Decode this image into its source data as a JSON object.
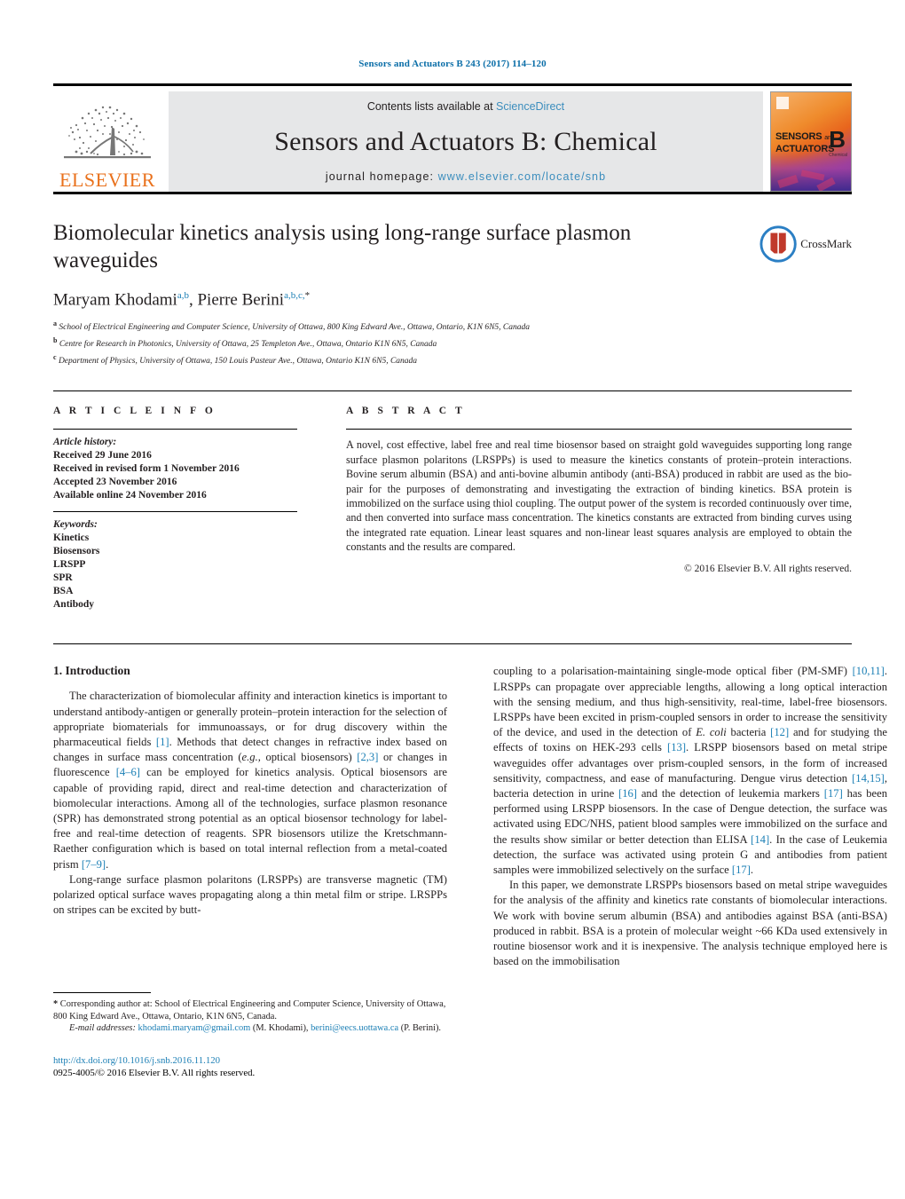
{
  "running_head": "Sensors and Actuators B 243 (2017) 114–120",
  "masthead": {
    "publisher": "ELSEVIER",
    "contents_prefix": "Contents lists available at ",
    "contents_link": "ScienceDirect",
    "journal_title": "Sensors and Actuators B: Chemical",
    "homepage_prefix": "journal homepage: ",
    "homepage_url": "www.elsevier.com/locate/snb",
    "cover": {
      "line1": "SENSORS",
      "line1_small": "and",
      "line2": "ACTUATORS",
      "letter": "B",
      "letter_sub": "Chemical"
    }
  },
  "article": {
    "title": "Biomolecular kinetics analysis using long-range surface plasmon waveguides",
    "crossmark_label": "CrossMark",
    "authors_html": "Maryam Khodami<sup>a,b</sup>, Pierre Berini<sup>a,b,c,<span class=\"star\">*</span></sup>",
    "affiliations": [
      {
        "mark": "a",
        "text": "School of Electrical Engineering and Computer Science, University of Ottawa, 800 King Edward Ave., Ottawa, Ontario, K1N 6N5, Canada"
      },
      {
        "mark": "b",
        "text": "Centre for Research in Photonics, University of Ottawa, 25 Templeton Ave., Ottawa, Ontario K1N 6N5, Canada"
      },
      {
        "mark": "c",
        "text": "Department of Physics, University of Ottawa, 150 Louis Pasteur Ave., Ottawa, Ontario K1N 6N5, Canada"
      }
    ]
  },
  "article_info": {
    "heading": "A R T I C L E    I N F O",
    "history_title": "Article history:",
    "history": [
      "Received 29 June 2016",
      "Received in revised form 1 November 2016",
      "Accepted 23 November 2016",
      "Available online 24 November 2016"
    ],
    "keywords_title": "Keywords:",
    "keywords": [
      "Kinetics",
      "Biosensors",
      "LRSPP",
      "SPR",
      "BSA",
      "Antibody"
    ]
  },
  "abstract": {
    "heading": "A B S T R A C T",
    "text": "A novel, cost effective, label free and real time biosensor based on straight gold waveguides supporting long range surface plasmon polaritons (LRSPPs) is used to measure the kinetics constants of protein–protein interactions. Bovine serum albumin (BSA) and anti-bovine albumin antibody (anti-BSA) produced in rabbit are used as the bio-pair for the purposes of demonstrating and investigating the extraction of binding kinetics. BSA protein is immobilized on the surface using thiol coupling. The output power of the system is recorded continuously over time, and then converted into surface mass concentration. The kinetics constants are extracted from binding curves using the integrated rate equation. Linear least squares and non-linear least squares analysis are employed to obtain the constants and the results are compared.",
    "copyright": "© 2016 Elsevier B.V. All rights reserved."
  },
  "body": {
    "section_heading": "1.  Introduction",
    "left_paragraphs": [
      "The characterization of biomolecular affinity and interaction kinetics is important to understand antibody-antigen or generally protein–protein interaction for the selection of appropriate biomaterials for immunoassays, or for drug discovery within the pharmaceutical fields <span class=\"ref\">[1]</span>. Methods that detect changes in refractive index based on changes in surface mass concentration (<span class=\"ital\">e.g.,</span> optical biosensors) <span class=\"ref\">[2,3]</span> or changes in fluorescence <span class=\"ref\">[4–6]</span> can be employed for kinetics analysis. Optical biosensors are capable of providing rapid, direct and real-time detection and characterization of biomolecular interactions. Among all of the technologies, surface plasmon resonance (SPR) has demonstrated strong potential as an optical biosensor technology for label-free and real-time detection of reagents. SPR biosensors utilize the Kretschmann-Raether configuration which is based on total internal reflection from a metal-coated prism <span class=\"ref\">[7–9]</span>.",
      "Long-range surface plasmon polaritons (LRSPPs) are transverse magnetic (TM) polarized optical surface waves propagating along a thin metal film or stripe. LRSPPs on stripes can be excited by butt-"
    ],
    "right_paragraphs": [
      "coupling to a polarisation-maintaining single-mode optical fiber (PM-SMF) <span class=\"ref\">[10,11]</span>. LRSPPs can propagate over appreciable lengths, allowing a long optical interaction with the sensing medium, and thus high-sensitivity, real-time, label-free biosensors. LRSPPs have been excited in prism-coupled sensors in order to increase the sensitivity of the device, and used in the detection of <span class=\"ital\">E. coli</span> bacteria <span class=\"ref\">[12]</span> and for studying the effects of toxins on HEK-293 cells <span class=\"ref\">[13]</span>. LRSPP biosensors based on metal stripe waveguides offer advantages over prism-coupled sensors, in the form of increased sensitivity, compactness, and ease of manufacturing. Dengue virus detection <span class=\"ref\">[14,15]</span>, bacteria detection in urine <span class=\"ref\">[16]</span> and the detection of leukemia markers <span class=\"ref\">[17]</span> has been performed using LRSPP biosensors. In the case of Dengue detection, the surface was activated using EDC/NHS, patient blood samples were immobilized on the surface and the results show similar or better detection than ELISA <span class=\"ref\">[14]</span>. In the case of Leukemia detection, the surface was activated using protein G and antibodies from patient samples were immobilized selectively on the surface <span class=\"ref\">[17]</span>.",
      "In this paper, we demonstrate LRSPPs biosensors based on metal stripe waveguides for the analysis of the affinity and kinetics rate constants of biomolecular interactions. We work with bovine serum albumin (BSA) and antibodies against BSA (anti-BSA) produced in rabbit. BSA is a protein of molecular weight ~66 KDa used extensively in routine biosensor work and it is inexpensive. The analysis technique employed here is based on the immobilisation"
    ]
  },
  "footnotes": {
    "corresponding_html": "<span style=\"font-weight:bold\">*</span> Corresponding author at: School of Electrical Engineering and Computer Science, University of Ottawa, 800 King Edward Ave., Ottawa, Ontario, K1N 6N5, Canada.",
    "email_html": "<span class=\"ital\">E-mail addresses:</span> <span class=\"lnk\">khodami.maryam@gmail.com</span> (M. Khodami), <span class=\"lnk\">berini@eecs.uottawa.ca</span> (P. Berini).",
    "doi": "http://dx.doi.org/10.1016/j.snb.2016.11.120",
    "issn_line": "0925-4005/© 2016 Elsevier B.V. All rights reserved."
  },
  "colors": {
    "link": "#1b7fb5",
    "sciencedirect": "#3b8dbd",
    "elsevier_orange": "#E9711C",
    "masthead_bg": "#e6e7e8",
    "text": "#231f20"
  }
}
